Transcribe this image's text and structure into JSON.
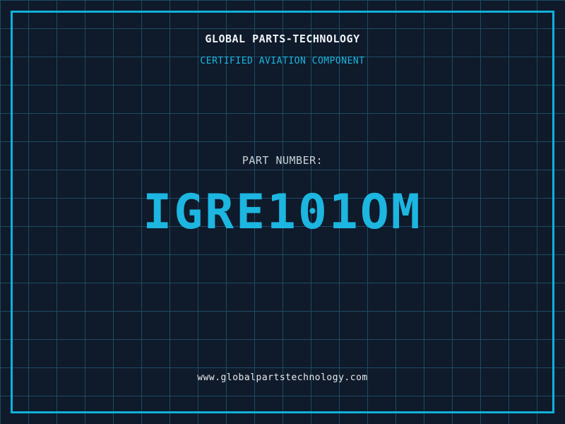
{
  "header": {
    "company": "GLOBAL PARTS-TECHNOLOGY",
    "certification": "CERTIFIED AVIATION COMPONENT"
  },
  "part": {
    "label": "PART NUMBER:",
    "number": "IGRE101OM"
  },
  "footer": {
    "website": "www.globalpartstechnology.com"
  },
  "colors": {
    "background": "#0f1a2b",
    "grid": "#1c4c62",
    "frame": "#0fb2da",
    "accent": "#1cb6e0",
    "title": "#eef3f6",
    "label": "#c9d2d9",
    "url": "#e6ebee"
  }
}
